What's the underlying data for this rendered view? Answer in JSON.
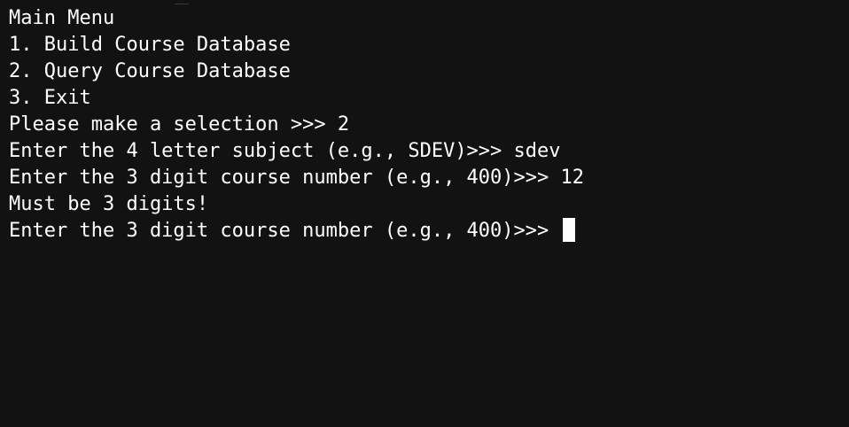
{
  "terminal": {
    "lines": [
      {
        "text": "Main Menu",
        "input": ""
      },
      {
        "text": "1. Build Course Database",
        "input": ""
      },
      {
        "text": "2. Query Course Database",
        "input": ""
      },
      {
        "text": "3. Exit",
        "input": ""
      },
      {
        "text": "Please make a selection >>> ",
        "input": "2"
      },
      {
        "text": "Enter the 4 letter subject (e.g., SDEV)>>> ",
        "input": "sdev"
      },
      {
        "text": "Enter the 3 digit course number (e.g., 400)>>> ",
        "input": "12"
      },
      {
        "text": "Must be 3 digits!",
        "input": ""
      }
    ],
    "current_prompt": "Enter the 3 digit course number (e.g., 400)>>> ",
    "current_input": ""
  },
  "colors": {
    "background": "#121212",
    "text": "#ffffff",
    "cursor": "#ffffff"
  }
}
